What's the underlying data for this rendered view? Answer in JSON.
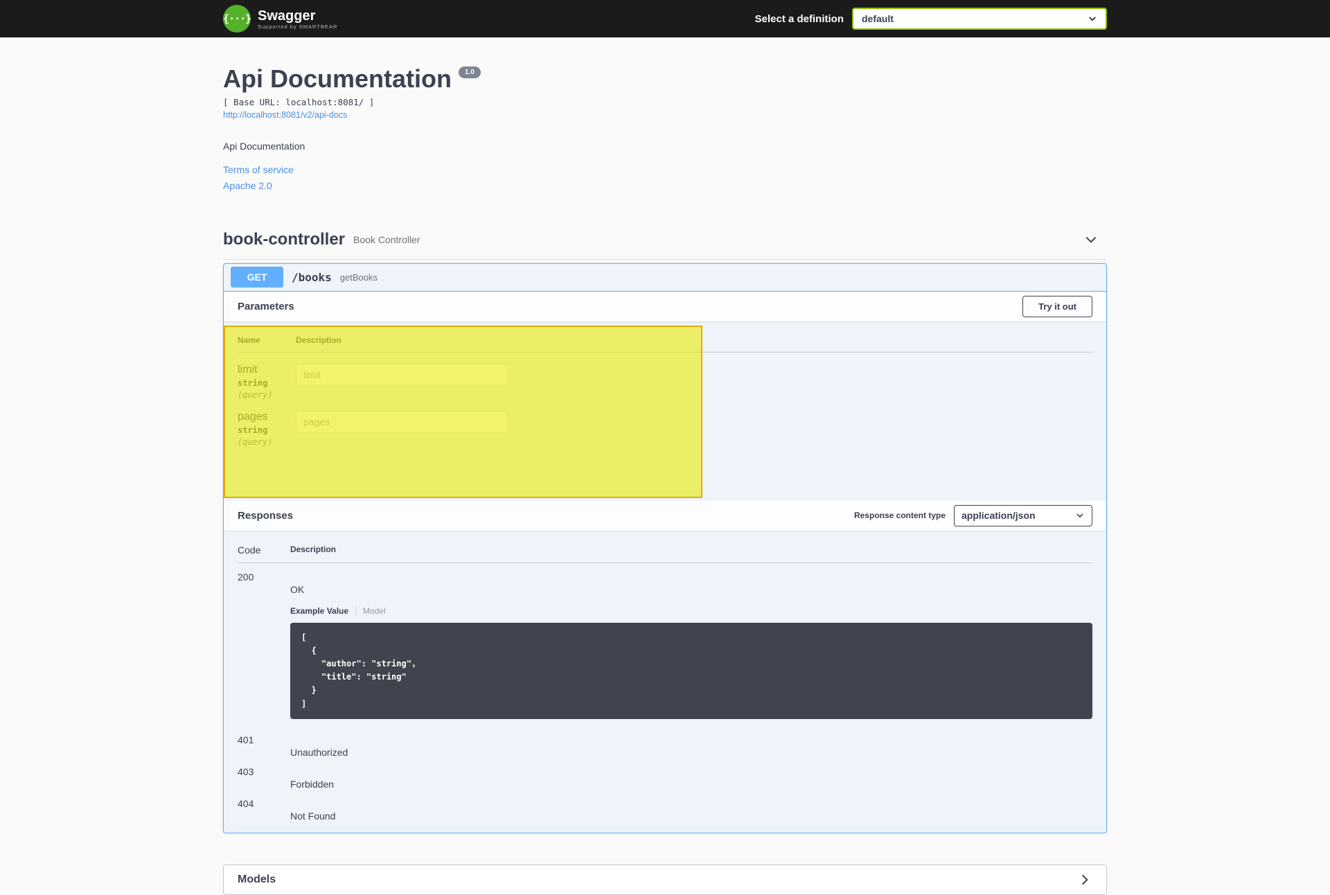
{
  "topbar": {
    "logo_text": "Swagger",
    "logo_glyph": "{···}",
    "logo_tagline": "Supported by SMARTBEAR",
    "select_label": "Select a definition",
    "selected_definition": "default"
  },
  "info": {
    "title": "Api Documentation",
    "version": "1.0",
    "base_url": "[ Base URL: localhost:8081/ ]",
    "api_docs_link": "http://localhost:8081/v2/api-docs",
    "description": "Api Documentation",
    "terms_link": "Terms of service",
    "license_link": "Apache 2.0"
  },
  "tag": {
    "name": "book-controller",
    "description": "Book Controller"
  },
  "operation": {
    "method": "GET",
    "path": "/books",
    "summary": "getBooks",
    "parameters": {
      "title": "Parameters",
      "try_it_out": "Try it out",
      "columns": {
        "name": "Name",
        "description": "Description"
      },
      "rows": [
        {
          "name": "limit",
          "type": "string",
          "location": "(query)",
          "placeholder": "limit"
        },
        {
          "name": "pages",
          "type": "string",
          "location": "(query)",
          "placeholder": "pages"
        }
      ]
    },
    "responses": {
      "title": "Responses",
      "content_type_label": "Response content type",
      "content_type": "application/json",
      "columns": {
        "code": "Code",
        "description": "Description"
      },
      "rows": [
        {
          "code": "200",
          "description": "OK",
          "tabs": {
            "example": "Example Value",
            "model": "Model"
          },
          "example_json": "[\n  {\n    \"author\": \"string\",\n    \"title\": \"string\"\n  }\n]"
        },
        {
          "code": "401",
          "description": "Unauthorized"
        },
        {
          "code": "403",
          "description": "Forbidden"
        },
        {
          "code": "404",
          "description": "Not Found"
        }
      ]
    }
  },
  "models": {
    "title": "Models"
  },
  "colors": {
    "topbar_bg": "#1b1b1b",
    "swagger_green": "#55b02a",
    "select_border_green": "#89bf04",
    "get_blue": "#61affe",
    "link_blue": "#4990e2",
    "text_dark": "#3b4151",
    "code_bg": "#41444e",
    "highlight_fill": "#e9eb0f",
    "highlight_border": "#e0ac00",
    "version_badge_bg": "#7d8492"
  }
}
